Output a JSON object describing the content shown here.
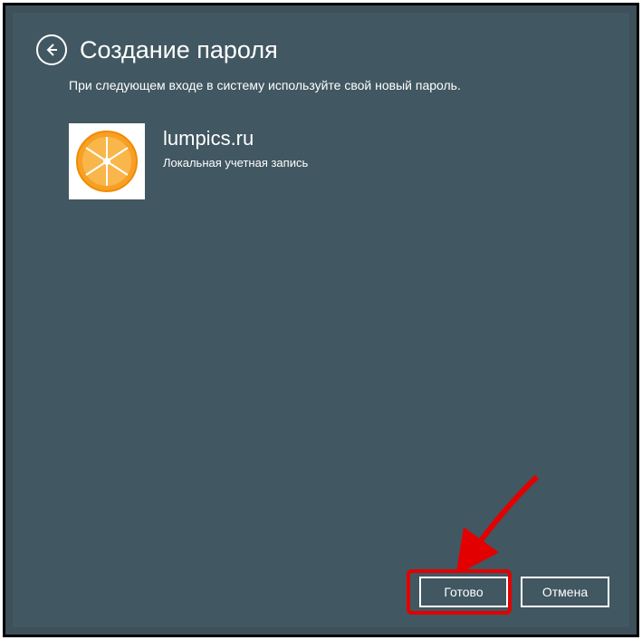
{
  "header": {
    "title": "Создание пароля",
    "subtitle": "При следующем входе в систему используйте свой новый пароль."
  },
  "account": {
    "name": "lumpics.ru",
    "type": "Локальная учетная запись",
    "avatar_icon": "orange-slice-icon"
  },
  "buttons": {
    "done": "Готово",
    "cancel": "Отмена"
  },
  "annotation": {
    "highlight_target": "done-button",
    "arrow_color": "#e30000"
  }
}
